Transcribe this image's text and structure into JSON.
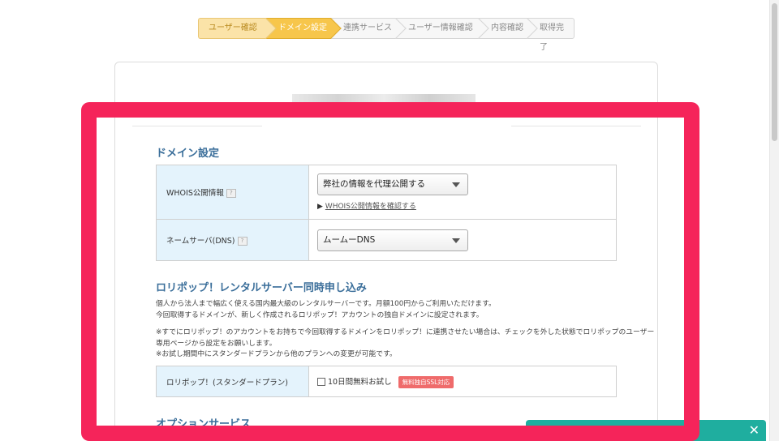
{
  "steps": [
    {
      "label": "ユーザー確認",
      "state": "done"
    },
    {
      "label": "ドメイン設定",
      "state": "current"
    },
    {
      "label": "連携サービス",
      "state": "todo"
    },
    {
      "label": "ユーザー情報確認",
      "state": "todo"
    },
    {
      "label": "内容確認",
      "state": "todo"
    },
    {
      "label": "取得完了",
      "state": "todo"
    }
  ],
  "domain_settings": {
    "title": "ドメイン設定",
    "whois": {
      "label": "WHOIS公開情報",
      "help": "?",
      "selected": "弊社の情報を代理公開する",
      "link_prefix": "▶",
      "link_text": "WHOIS公開情報を確認する"
    },
    "nameserver": {
      "label": "ネームサーバ(DNS)",
      "help": "?",
      "selected": "ムームーDNS"
    }
  },
  "lolipop": {
    "title": "ロリポップ！レンタルサーバー同時申し込み",
    "para1_line1": "個人から法人まで幅広く使える国内最大級のレンタルサーバーです。月額100円からご利用いただけます。",
    "para1_line2": "今回取得するドメインが、新しく作成されるロリポップ！アカウントの独自ドメインに設定されます。",
    "para2_line1": "※すでにロリポップ！のアカウントをお持ちで今回取得するドメインをロリポップ！に連携させたい場合は、チェックを外した状態でロリポップのユーザー",
    "para2_line2": "専用ページから設定をお願いします。",
    "para2_line3": "※お試し期間中にスタンダードプランから他のプランへの変更が可能です。",
    "plan_label": "ロリポップ！(スタンダードプラン)",
    "trial_label": "10日間無料お試し",
    "trial_checked": false,
    "badge": "無料独自SSL対応"
  },
  "options": {
    "title": "オプションサービス"
  },
  "bottom_bar": {
    "close": "✕"
  },
  "colors": {
    "highlight": "#f5245a",
    "accent_title": "#3a6e9a",
    "step_current": "#f7c64b",
    "label_bg": "#e4f3fc",
    "badge": "#ef6b6b",
    "bottom_bar": "#1fae9f"
  }
}
